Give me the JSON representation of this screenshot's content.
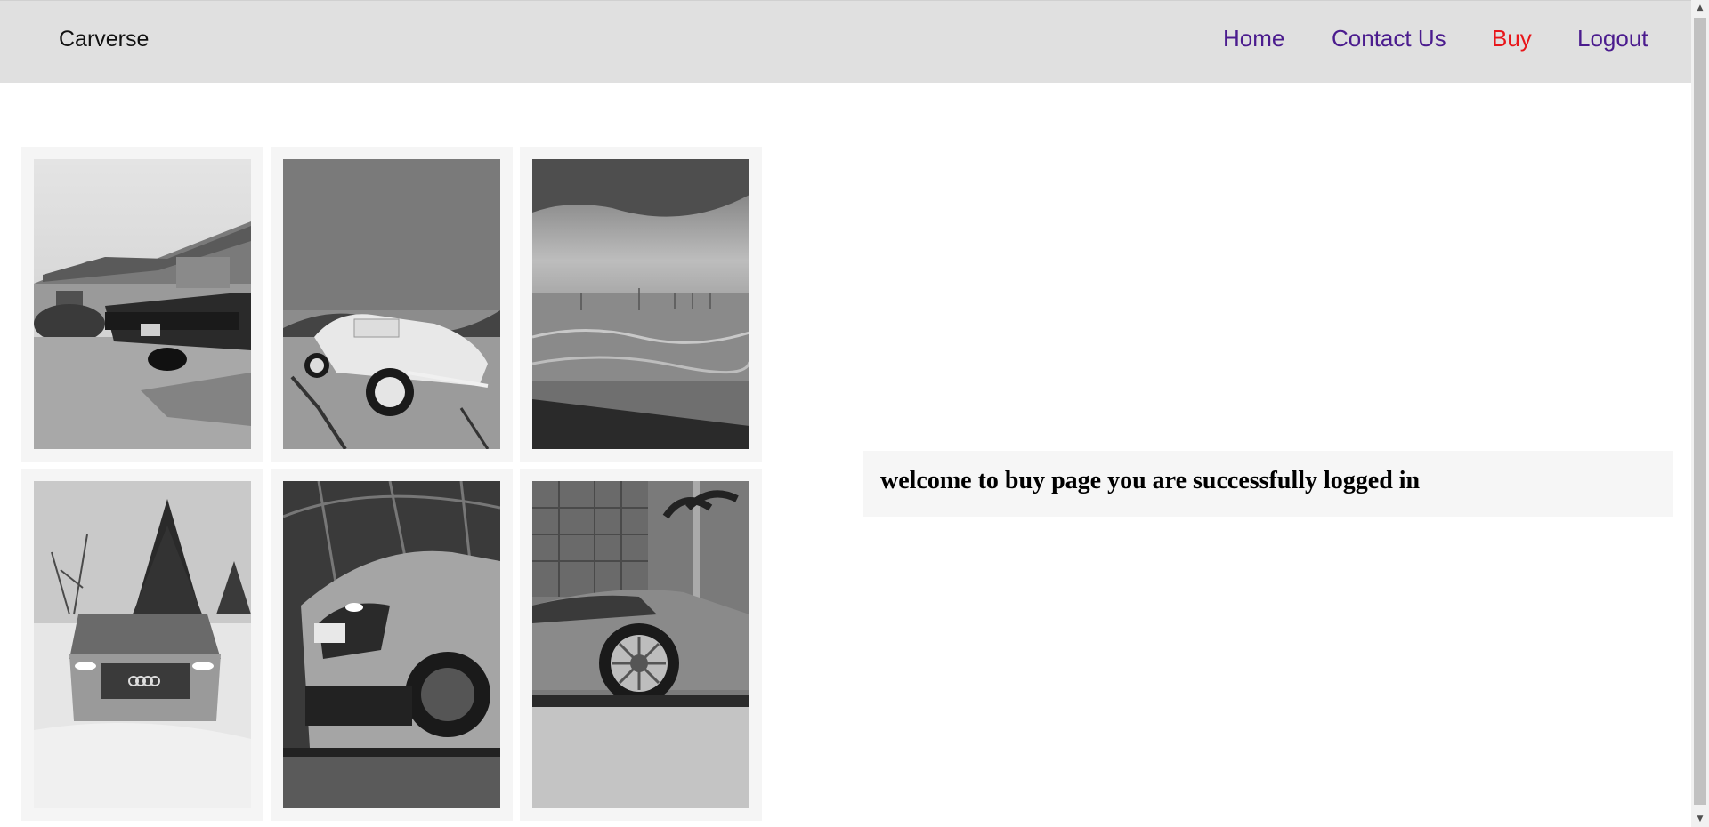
{
  "nav": {
    "brand": "Carverse",
    "links": [
      {
        "label": "Home"
      },
      {
        "label": "Contact Us"
      },
      {
        "label": "Buy"
      },
      {
        "label": "Logout"
      }
    ],
    "active_color": "#e8161a",
    "link_color": "#4b1c8e"
  },
  "gallery": {
    "photos": [
      {
        "subject": "classic-car-at-house"
      },
      {
        "subject": "vintage-white-roadster"
      },
      {
        "subject": "beach-with-wind-turbines"
      },
      {
        "subject": "audi-in-snow"
      },
      {
        "subject": "audi-r8-rear"
      },
      {
        "subject": "lamborghini-side"
      }
    ]
  },
  "main": {
    "welcome": "welcome to buy page you are successfully logged in"
  },
  "scrollbar": {
    "up_icon": "triangle-up",
    "down_icon": "triangle-down"
  }
}
